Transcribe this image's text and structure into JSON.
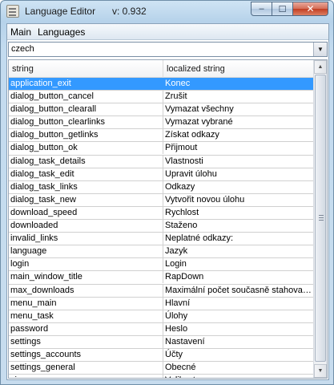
{
  "window": {
    "title": "Language Editor",
    "version": "v: 0.932",
    "controls": {
      "minimize": "–",
      "maximize": "☐",
      "close": "✕"
    }
  },
  "menu": {
    "main": "Main",
    "languages": "Languages"
  },
  "language_select": {
    "value": "czech"
  },
  "table": {
    "columns": [
      "string",
      "localized string"
    ],
    "selected_row": 0,
    "rows": [
      {
        "key": "application_exit",
        "value": "Konec"
      },
      {
        "key": "dialog_button_cancel",
        "value": "Zrušit"
      },
      {
        "key": "dialog_button_clearall",
        "value": "Vymazat všechny"
      },
      {
        "key": "dialog_button_clearlinks",
        "value": "Vymazat vybrané"
      },
      {
        "key": "dialog_button_getlinks",
        "value": "Získat odkazy"
      },
      {
        "key": "dialog_button_ok",
        "value": "Přijmout"
      },
      {
        "key": "dialog_task_details",
        "value": "Vlastnosti"
      },
      {
        "key": "dialog_task_edit",
        "value": "Upravit úlohu"
      },
      {
        "key": "dialog_task_links",
        "value": "Odkazy"
      },
      {
        "key": "dialog_task_new",
        "value": "Vytvořit novou úlohu"
      },
      {
        "key": "download_speed",
        "value": "Rychlost"
      },
      {
        "key": "downloaded",
        "value": "Staženo"
      },
      {
        "key": "invalid_links",
        "value": "Neplatné odkazy:"
      },
      {
        "key": "language",
        "value": "Jazyk"
      },
      {
        "key": "login",
        "value": "Login"
      },
      {
        "key": "main_window_title",
        "value": "RapDown"
      },
      {
        "key": "max_downloads",
        "value": "Maximální počet současně stahovanýc..."
      },
      {
        "key": "menu_main",
        "value": "Hlavní"
      },
      {
        "key": "menu_task",
        "value": "Úlohy"
      },
      {
        "key": "password",
        "value": "Heslo"
      },
      {
        "key": "settings",
        "value": "Nastavení"
      },
      {
        "key": "settings_accounts",
        "value": "Účty"
      },
      {
        "key": "settings_general",
        "value": "Obecné"
      },
      {
        "key": "size",
        "value": "Velikost"
      }
    ]
  }
}
